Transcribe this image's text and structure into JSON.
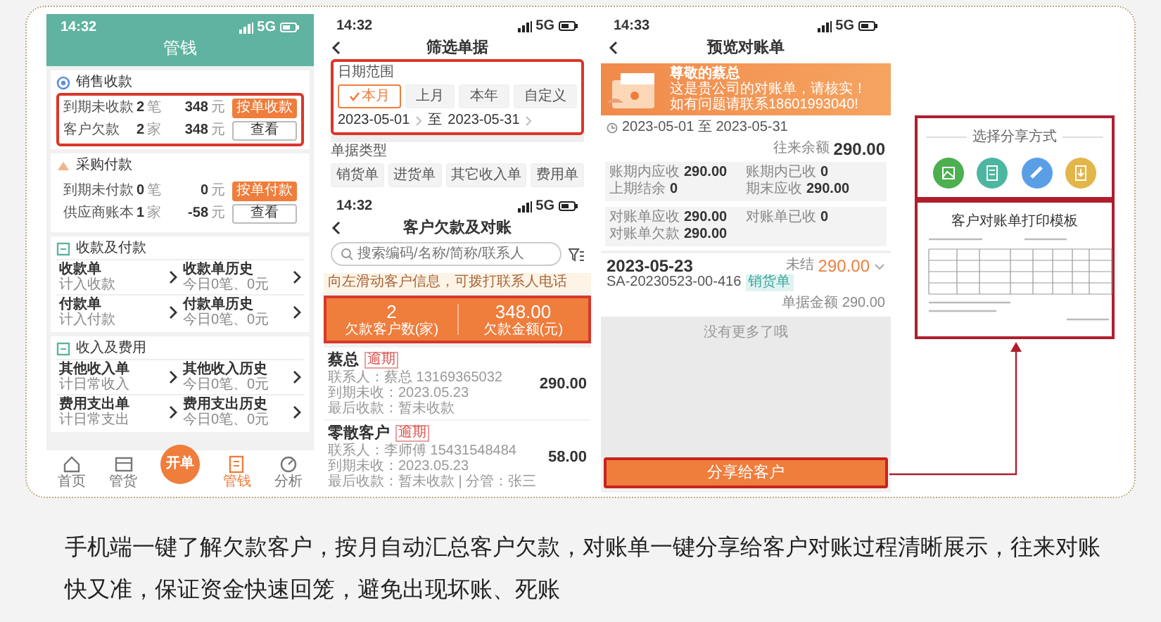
{
  "money_screen": {
    "time": "14:32",
    "network": "5G",
    "title": "管钱",
    "balance_sections": [
      {
        "title": "销售收款",
        "kind": "sales",
        "highlighted": true,
        "rows": [
          {
            "label": "到期未收款",
            "count": "2",
            "count_unit": "笔",
            "amount": "348",
            "amount_unit": "元",
            "action": "按单收款",
            "kind": "primary"
          },
          {
            "label": "客户欠款",
            "count": "2",
            "count_unit": "家",
            "amount": "348",
            "amount_unit": "元",
            "action": "查看",
            "kind": "outline"
          }
        ]
      },
      {
        "title": "采购付款",
        "kind": "purchase",
        "highlighted": false,
        "rows": [
          {
            "label": "到期未付款",
            "count": "0",
            "count_unit": "笔",
            "amount": "0",
            "amount_unit": "元",
            "action": "按单付款",
            "kind": "primary"
          },
          {
            "label": "供应商账本",
            "count": "1",
            "count_unit": "家",
            "amount": "-58",
            "amount_unit": "元",
            "action": "查看",
            "kind": "outline"
          }
        ]
      }
    ],
    "grid_sections": [
      {
        "title": "收款及付款",
        "items": [
          {
            "title": "收款单",
            "subtitle": "计入收款"
          },
          {
            "title": "收款单历史",
            "subtitle": "今日0笔、0元"
          },
          {
            "title": "付款单",
            "subtitle": "计入付款"
          },
          {
            "title": "付款单历史",
            "subtitle": "今日0笔、0元"
          }
        ]
      },
      {
        "title": "收入及费用",
        "items": [
          {
            "title": "其他收入单",
            "subtitle": "计日常收入"
          },
          {
            "title": "其他收入历史",
            "subtitle": "今日0笔、0元"
          },
          {
            "title": "费用支出单",
            "subtitle": "计日常支出"
          },
          {
            "title": "费用支出历史",
            "subtitle": "今日0笔、0元"
          }
        ]
      }
    ],
    "nav": [
      {
        "label": "首页",
        "kind": "home",
        "selected": false
      },
      {
        "label": "管货",
        "kind": "goods",
        "selected": false
      },
      {
        "label": "开单",
        "kind": "create",
        "selected": false
      },
      {
        "label": "管钱",
        "kind": "money",
        "selected": true
      },
      {
        "label": "分析",
        "kind": "analysis",
        "selected": false
      }
    ]
  },
  "filter_screen": {
    "time": "14:32",
    "network": "5G",
    "title": "筛选单据",
    "date_range": {
      "label": "日期范围",
      "highlighted": true,
      "options": [
        {
          "label": "本月",
          "selected": true
        },
        {
          "label": "上月",
          "selected": false
        },
        {
          "label": "本年",
          "selected": false
        },
        {
          "label": "自定义",
          "selected": false
        }
      ],
      "start": "2023-05-01",
      "separator": "至",
      "end": "2023-05-31"
    },
    "doc_type": {
      "label": "单据类型",
      "options": [
        {
          "label": "销货单",
          "selected": false
        },
        {
          "label": "进货单",
          "selected": false
        },
        {
          "label": "其它收入单",
          "selected": false
        },
        {
          "label": "费用单",
          "selected": false
        }
      ]
    }
  },
  "debt_screen": {
    "time": "14:32",
    "network": "5G",
    "title": "客户欠款及对账",
    "search": {
      "placeholder": "搜索编码/名称/简称/联系人"
    },
    "hint": "向左滑动客户信息，可拨打联系人电话",
    "summary": {
      "highlighted": true,
      "stats": [
        {
          "value": "2",
          "label": "欠款客户数(家)"
        },
        {
          "value": "348.00",
          "label": "欠款金额(元)"
        }
      ]
    },
    "customers": [
      {
        "name": "蔡总",
        "tag": "逾期",
        "lines": [
          "联系人：蔡总 13169365032",
          "到期未收：2023.05.23",
          "最后收款：暂未收款"
        ],
        "amount": "290.00"
      },
      {
        "name": "零散客户",
        "tag": "逾期",
        "lines": [
          "联系人：李师傅 15431548484",
          "到期未收：2023.05.23",
          "最后收款：暂未收款 | 分管：张三"
        ],
        "amount": "58.00"
      }
    ]
  },
  "statement_screen": {
    "time": "14:33",
    "network": "5G",
    "title": "预览对账单",
    "banner": {
      "greeting": "尊敬的蔡总",
      "message": "这是贵公司的对账单，请核实！",
      "contact": "如有问题请联系18601993040!"
    },
    "period": "2023-05-01 至 2023-05-31",
    "balance_label": "往来余额",
    "balance": "290.00",
    "summary_groups": [
      [
        {
          "label": "账期内应收",
          "value": "290.00"
        },
        {
          "label": "账期内已收",
          "value": "0"
        },
        {
          "label": "上期结余",
          "value": "0"
        },
        {
          "label": "期末应收",
          "value": "290.00"
        }
      ],
      [
        {
          "label": "对账单应收",
          "value": "290.00"
        },
        {
          "label": "对账单已收",
          "value": "0"
        },
        {
          "label": "对账单欠款",
          "value": "290.00"
        }
      ]
    ],
    "entries": [
      {
        "date": "2023-05-23",
        "status": "未结",
        "amount": "290.00",
        "number": "SA-20230523-00-416",
        "type": "销货单",
        "total_label": "单据金额",
        "total": "290.00"
      }
    ],
    "end_note": "没有更多了哦",
    "share_button": {
      "label": "分享给客户",
      "highlighted": true
    }
  },
  "share_panel": {
    "title": "选择分享方式",
    "highlighted": true,
    "options": [
      {
        "kind": "image",
        "color": "#4caf50"
      },
      {
        "kind": "document",
        "color": "#4db6a0"
      },
      {
        "kind": "link",
        "color": "#5a9fe6"
      },
      {
        "kind": "download",
        "color": "#e3b64a"
      }
    ],
    "document": {
      "title": "客户对账单打印模板",
      "highlighted": true
    }
  },
  "caption": "手机端一键了解欠款客户，按月自动汇总客户欠款，对账单一键分享给客户对账过程清晰展示，往来对账快又准，保证资金快速回笼，避免出现坏账、死账"
}
